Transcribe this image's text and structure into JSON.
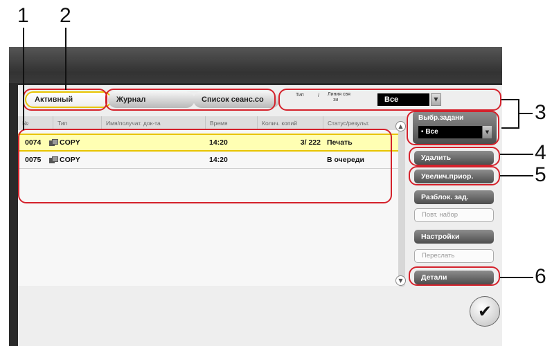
{
  "callouts": [
    "1",
    "2",
    "3",
    "4",
    "5",
    "6"
  ],
  "tabs": [
    "Активный",
    "Журнал",
    "Список сеанс.со"
  ],
  "job_type_filter": {
    "label_line1": "Тип",
    "label_line2": "/",
    "label_line3": "Линия свя",
    "label_line4": "зи",
    "value": "Все"
  },
  "columns": [
    "№",
    "Тип",
    "Имя/получат. док-та",
    "Время",
    "Колич. копий",
    "Статус/результ."
  ],
  "rows": [
    {
      "no": "0074",
      "type": "COPY",
      "name": "",
      "time": "14:20",
      "copies": "3/ 222",
      "status": "Печать",
      "selected": true
    },
    {
      "no": "0075",
      "type": "COPY",
      "name": "",
      "time": "14:20",
      "copies": "",
      "status": "В очереди",
      "selected": false
    }
  ],
  "select_job": {
    "label": "Выбр.задани",
    "value": "Все"
  },
  "buttons": {
    "delete": "Удалить",
    "increase_priority": "Увелич.приор.",
    "release_job": "Разблок. зад.",
    "redial": "Повт. набор",
    "settings": "Настройки",
    "forward": "Переслать",
    "details": "Детали"
  },
  "icons": {
    "job": "copy-job-icon",
    "scroll_up": "chevron-up-icon",
    "scroll_down": "chevron-down-icon",
    "ok": "checkmark-icon"
  },
  "colors": {
    "highlight": "#e8c400",
    "selected_row": "#ffffb3",
    "callout_ring": "#d4212b"
  }
}
